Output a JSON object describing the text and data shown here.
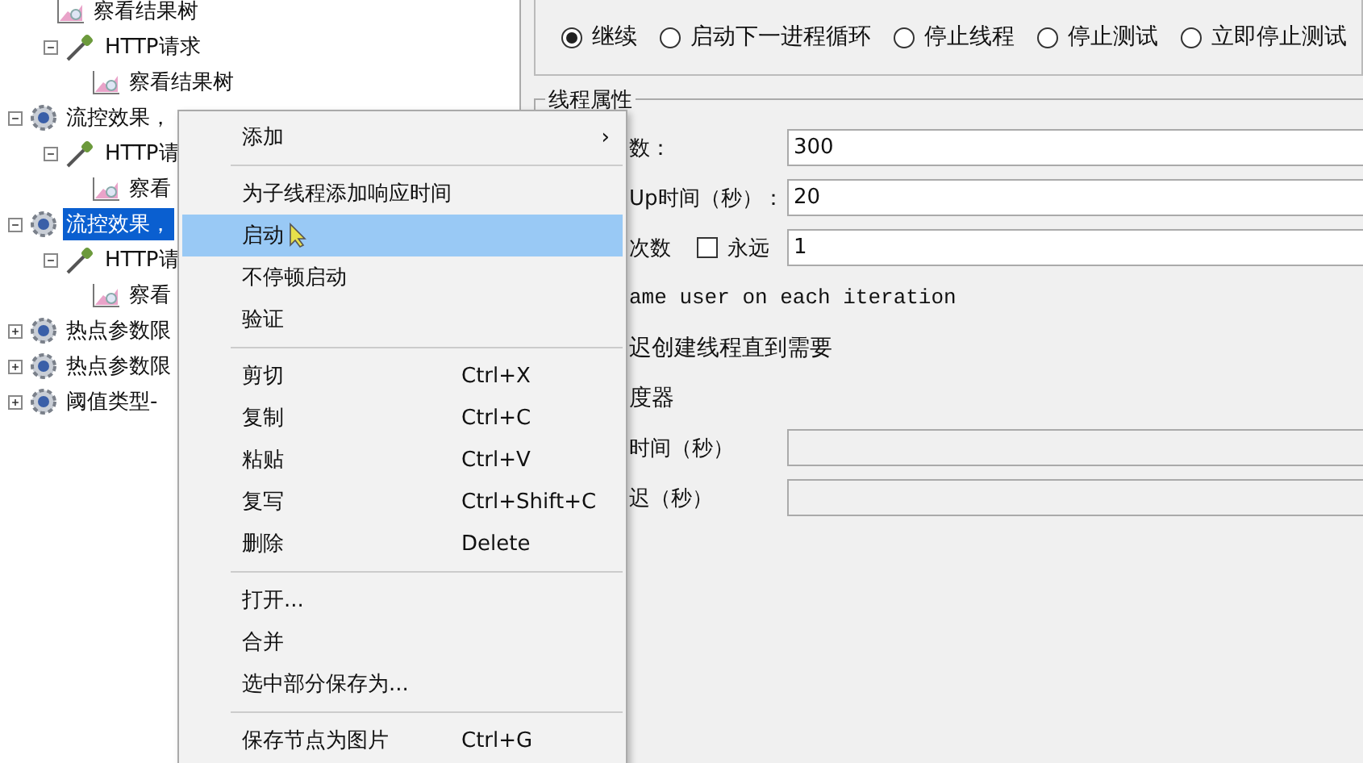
{
  "tree": [
    {
      "kind": "group",
      "children": [
        {
          "kind": "sampler",
          "children": [
            {
              "kind": "listener",
              "label": "察看结果树"
            }
          ]
        },
        {
          "kind": "sampler",
          "label": "HTTP请求",
          "expanded": true,
          "children": [
            {
              "kind": "listener",
              "label": "察看结果树"
            }
          ]
        }
      ]
    },
    {
      "kind": "group",
      "label": "流控效果，",
      "expanded": true,
      "selected": false,
      "children": [
        {
          "kind": "sampler",
          "label": "HTTP请",
          "expanded": true,
          "children": [
            {
              "kind": "listener",
              "label": "察看"
            }
          ]
        }
      ]
    },
    {
      "kind": "group",
      "label": "流控效果，",
      "expanded": true,
      "selected": true,
      "children": [
        {
          "kind": "sampler",
          "label": "HTTP请",
          "expanded": true,
          "children": [
            {
              "kind": "listener",
              "label": "察看"
            }
          ]
        }
      ]
    },
    {
      "kind": "group",
      "label": "热点参数限",
      "expanded": false,
      "selected": false
    },
    {
      "kind": "group",
      "label": "热点参数限",
      "expanded": false,
      "selected": false
    },
    {
      "kind": "group",
      "label": "阈值类型-",
      "expanded": false,
      "selected": false
    }
  ],
  "error_actions": [
    {
      "label": "继续",
      "selected": true
    },
    {
      "label": "启动下一进程循环",
      "selected": false
    },
    {
      "label": "停止线程",
      "selected": false
    },
    {
      "label": "停止测试",
      "selected": false
    },
    {
      "label": "立即停止测试",
      "selected": false
    }
  ],
  "thread_properties": {
    "title": "线程属性",
    "fields": [
      {
        "kind": "input",
        "label": "数：",
        "value": "300",
        "disabled": false
      },
      {
        "kind": "input",
        "label": "Up时间（秒）：",
        "value": "20",
        "disabled": false
      },
      {
        "kind": "loop",
        "label": "次数",
        "checkbox": {
          "label": "永远",
          "checked": false
        },
        "value": "1",
        "disabled": false
      },
      {
        "kind": "mono",
        "label": "ame user on each iteration"
      },
      {
        "kind": "text",
        "label": "迟创建线程直到需要"
      },
      {
        "kind": "text",
        "label": "度器"
      },
      {
        "kind": "input",
        "label": "时间（秒）",
        "disabled": true
      },
      {
        "kind": "input",
        "label": "迟（秒）",
        "disabled": true
      }
    ]
  },
  "context_menu": {
    "groups": [
      [
        {
          "label": "添加",
          "submenu": "›",
          "selected": false
        }
      ],
      [
        {
          "label": "为子线程添加响应时间",
          "selected": false
        },
        {
          "label": "启动",
          "selected": true
        },
        {
          "label": "不停顿启动",
          "selected": false
        },
        {
          "label": "验证",
          "selected": false
        }
      ],
      [
        {
          "label": "剪切",
          "shortcut": "Ctrl+X",
          "selected": false
        },
        {
          "label": "复制",
          "shortcut": "Ctrl+C",
          "selected": false
        },
        {
          "label": "粘贴",
          "shortcut": "Ctrl+V",
          "selected": false
        },
        {
          "label": "复写",
          "shortcut": "Ctrl+Shift+C",
          "selected": false
        },
        {
          "label": "删除",
          "shortcut": "Delete",
          "selected": false
        }
      ],
      [
        {
          "label": "打开...",
          "selected": false
        },
        {
          "label": "合并",
          "selected": false
        },
        {
          "label": "选中部分保存为...",
          "selected": false
        }
      ],
      [
        {
          "label": "保存节点为图片",
          "shortcut": "Ctrl+G",
          "selected": false
        }
      ]
    ]
  }
}
